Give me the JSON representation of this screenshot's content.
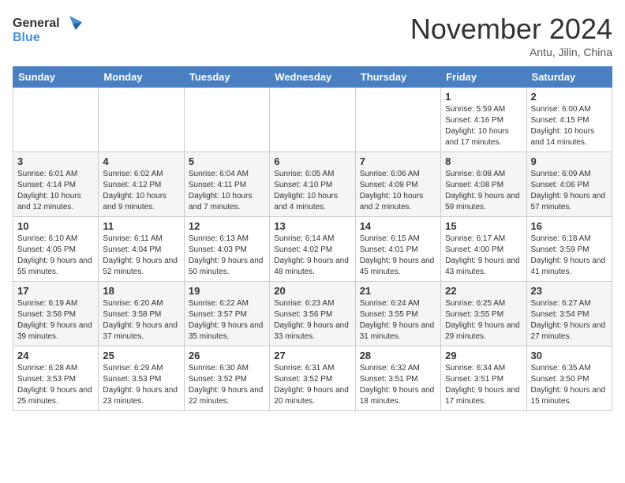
{
  "header": {
    "logo_general": "General",
    "logo_blue": "Blue",
    "month_year": "November 2024",
    "location": "Antu, Jilin, China"
  },
  "days_of_week": [
    "Sunday",
    "Monday",
    "Tuesday",
    "Wednesday",
    "Thursday",
    "Friday",
    "Saturday"
  ],
  "weeks": [
    [
      {
        "day": "",
        "info": ""
      },
      {
        "day": "",
        "info": ""
      },
      {
        "day": "",
        "info": ""
      },
      {
        "day": "",
        "info": ""
      },
      {
        "day": "",
        "info": ""
      },
      {
        "day": "1",
        "info": "Sunrise: 5:59 AM\nSunset: 4:16 PM\nDaylight: 10 hours and 17 minutes."
      },
      {
        "day": "2",
        "info": "Sunrise: 6:00 AM\nSunset: 4:15 PM\nDaylight: 10 hours and 14 minutes."
      }
    ],
    [
      {
        "day": "3",
        "info": "Sunrise: 6:01 AM\nSunset: 4:14 PM\nDaylight: 10 hours and 12 minutes."
      },
      {
        "day": "4",
        "info": "Sunrise: 6:02 AM\nSunset: 4:12 PM\nDaylight: 10 hours and 9 minutes."
      },
      {
        "day": "5",
        "info": "Sunrise: 6:04 AM\nSunset: 4:11 PM\nDaylight: 10 hours and 7 minutes."
      },
      {
        "day": "6",
        "info": "Sunrise: 6:05 AM\nSunset: 4:10 PM\nDaylight: 10 hours and 4 minutes."
      },
      {
        "day": "7",
        "info": "Sunrise: 6:06 AM\nSunset: 4:09 PM\nDaylight: 10 hours and 2 minutes."
      },
      {
        "day": "8",
        "info": "Sunrise: 6:08 AM\nSunset: 4:08 PM\nDaylight: 9 hours and 59 minutes."
      },
      {
        "day": "9",
        "info": "Sunrise: 6:09 AM\nSunset: 4:06 PM\nDaylight: 9 hours and 57 minutes."
      }
    ],
    [
      {
        "day": "10",
        "info": "Sunrise: 6:10 AM\nSunset: 4:05 PM\nDaylight: 9 hours and 55 minutes."
      },
      {
        "day": "11",
        "info": "Sunrise: 6:11 AM\nSunset: 4:04 PM\nDaylight: 9 hours and 52 minutes."
      },
      {
        "day": "12",
        "info": "Sunrise: 6:13 AM\nSunset: 4:03 PM\nDaylight: 9 hours and 50 minutes."
      },
      {
        "day": "13",
        "info": "Sunrise: 6:14 AM\nSunset: 4:02 PM\nDaylight: 9 hours and 48 minutes."
      },
      {
        "day": "14",
        "info": "Sunrise: 6:15 AM\nSunset: 4:01 PM\nDaylight: 9 hours and 45 minutes."
      },
      {
        "day": "15",
        "info": "Sunrise: 6:17 AM\nSunset: 4:00 PM\nDaylight: 9 hours and 43 minutes."
      },
      {
        "day": "16",
        "info": "Sunrise: 6:18 AM\nSunset: 3:59 PM\nDaylight: 9 hours and 41 minutes."
      }
    ],
    [
      {
        "day": "17",
        "info": "Sunrise: 6:19 AM\nSunset: 3:58 PM\nDaylight: 9 hours and 39 minutes."
      },
      {
        "day": "18",
        "info": "Sunrise: 6:20 AM\nSunset: 3:58 PM\nDaylight: 9 hours and 37 minutes."
      },
      {
        "day": "19",
        "info": "Sunrise: 6:22 AM\nSunset: 3:57 PM\nDaylight: 9 hours and 35 minutes."
      },
      {
        "day": "20",
        "info": "Sunrise: 6:23 AM\nSunset: 3:56 PM\nDaylight: 9 hours and 33 minutes."
      },
      {
        "day": "21",
        "info": "Sunrise: 6:24 AM\nSunset: 3:55 PM\nDaylight: 9 hours and 31 minutes."
      },
      {
        "day": "22",
        "info": "Sunrise: 6:25 AM\nSunset: 3:55 PM\nDaylight: 9 hours and 29 minutes."
      },
      {
        "day": "23",
        "info": "Sunrise: 6:27 AM\nSunset: 3:54 PM\nDaylight: 9 hours and 27 minutes."
      }
    ],
    [
      {
        "day": "24",
        "info": "Sunrise: 6:28 AM\nSunset: 3:53 PM\nDaylight: 9 hours and 25 minutes."
      },
      {
        "day": "25",
        "info": "Sunrise: 6:29 AM\nSunset: 3:53 PM\nDaylight: 9 hours and 23 minutes."
      },
      {
        "day": "26",
        "info": "Sunrise: 6:30 AM\nSunset: 3:52 PM\nDaylight: 9 hours and 22 minutes."
      },
      {
        "day": "27",
        "info": "Sunrise: 6:31 AM\nSunset: 3:52 PM\nDaylight: 9 hours and 20 minutes."
      },
      {
        "day": "28",
        "info": "Sunrise: 6:32 AM\nSunset: 3:51 PM\nDaylight: 9 hours and 18 minutes."
      },
      {
        "day": "29",
        "info": "Sunrise: 6:34 AM\nSunset: 3:51 PM\nDaylight: 9 hours and 17 minutes."
      },
      {
        "day": "30",
        "info": "Sunrise: 6:35 AM\nSunset: 3:50 PM\nDaylight: 9 hours and 15 minutes."
      }
    ]
  ]
}
